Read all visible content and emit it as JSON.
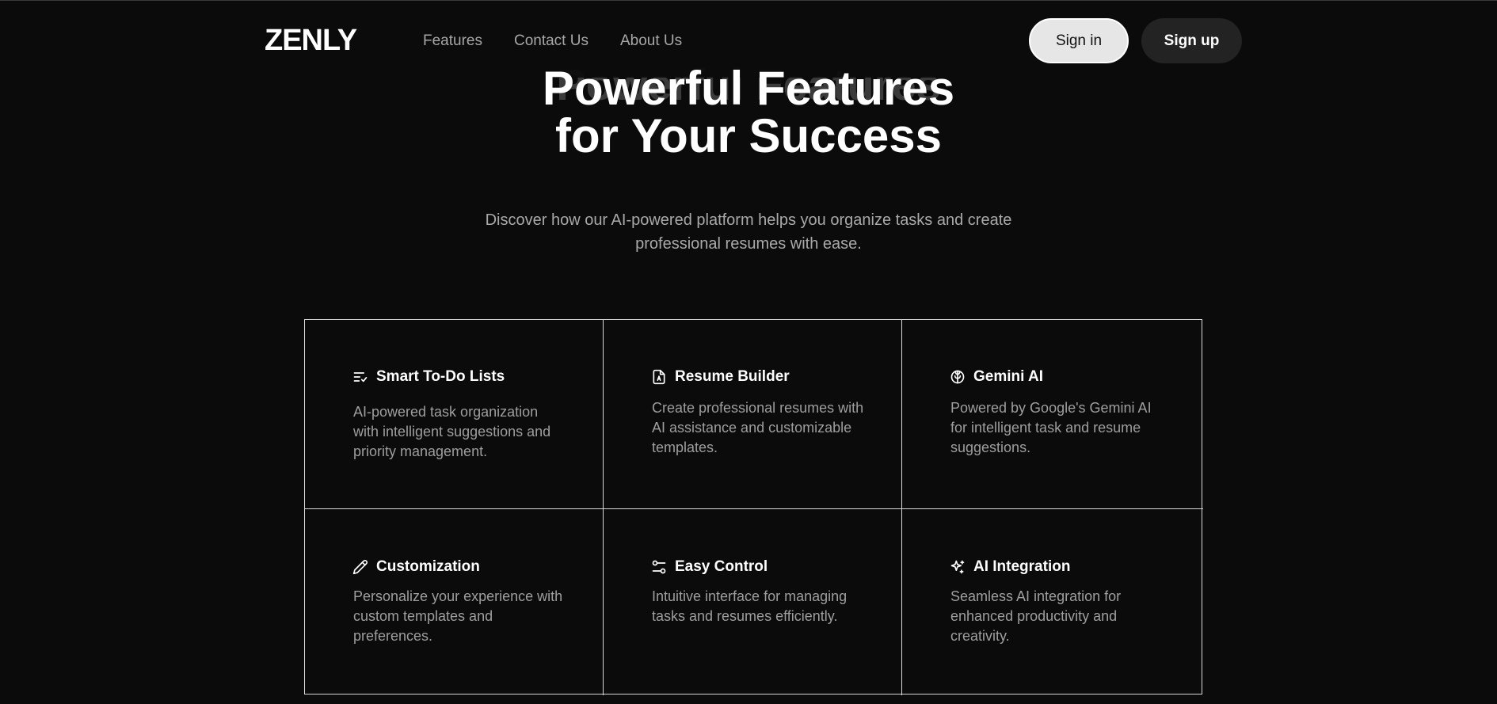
{
  "header": {
    "logo": "ZENLY",
    "nav": [
      "Features",
      "Contact Us",
      "About Us"
    ],
    "signin_label": "Sign in",
    "signup_label": "Sign up"
  },
  "hero": {
    "title_line1": "Powerful Features",
    "title_line2": "for Your Success",
    "subtitle": "Discover how our AI-powered platform helps you organize tasks and create professional resumes with ease."
  },
  "features": [
    {
      "icon": "list-check-icon",
      "title": "Smart To-Do Lists",
      "description": "AI-powered task organization with intelligent suggestions and priority management."
    },
    {
      "icon": "file-resume-icon",
      "title": "Resume Builder",
      "description": "Create professional resumes with AI assistance and customizable templates."
    },
    {
      "icon": "brain-icon",
      "title": "Gemini AI",
      "description": "Powered by Google's Gemini AI for intelligent task and resume suggestions."
    },
    {
      "icon": "pencil-icon",
      "title": "Customization",
      "description": "Personalize your experience with custom templates and preferences."
    },
    {
      "icon": "sliders-icon",
      "title": "Easy Control",
      "description": "Intuitive interface for managing tasks and resumes efficiently."
    },
    {
      "icon": "sparkles-icon",
      "title": "AI Integration",
      "description": "Seamless AI integration for enhanced productivity and creativity."
    }
  ],
  "colors": {
    "background": "#0b0b0b",
    "text": "#ffffff",
    "muted": "#a9a9a9",
    "grid_border": "#d9d9d9",
    "signin_bg": "#e6e6e6",
    "signup_bg": "#232323"
  }
}
